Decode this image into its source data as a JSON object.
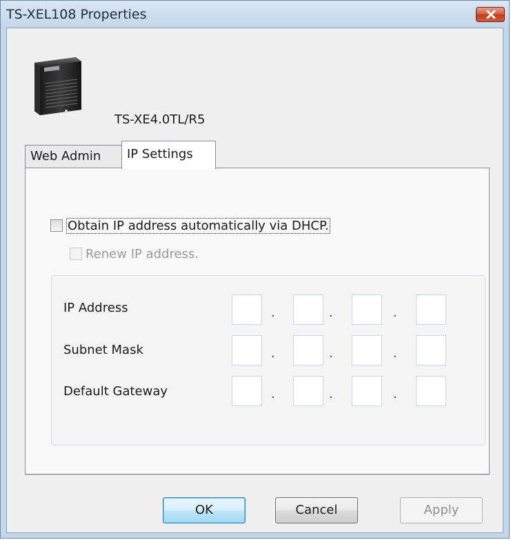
{
  "window": {
    "title": "TS-XEL108 Properties",
    "close_icon": "close-icon"
  },
  "device": {
    "icon": "nas-device-icon",
    "model": "TS-XE4.0TL/R5"
  },
  "tabs": [
    {
      "label": "Web Admin",
      "selected": false
    },
    {
      "label": "IP Settings",
      "selected": true
    }
  ],
  "ip_settings": {
    "dhcp_label": "Obtain IP address automatically via DHCP.",
    "dhcp_checked": false,
    "renew_label": "Renew IP address.",
    "renew_checked": false,
    "renew_enabled": false,
    "rows": [
      {
        "label": "IP Address",
        "octets": [
          "",
          "",
          "",
          ""
        ]
      },
      {
        "label": "Subnet Mask",
        "octets": [
          "",
          "",
          "",
          ""
        ]
      },
      {
        "label": "Default Gateway",
        "octets": [
          "",
          "",
          "",
          ""
        ]
      }
    ],
    "separator": "."
  },
  "buttons": {
    "ok": "OK",
    "cancel": "Cancel",
    "apply": "Apply",
    "apply_enabled": false
  },
  "colors": {
    "frame": "#c4d6ea",
    "close_button": "#c8452a",
    "default_button_border": "#3c7fb1"
  }
}
